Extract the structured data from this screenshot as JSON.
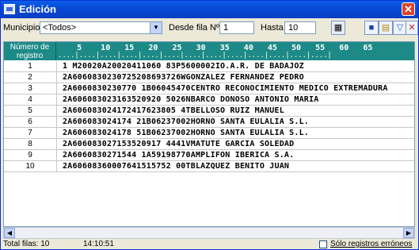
{
  "window": {
    "title": "Edición",
    "close_label": "✕"
  },
  "toolbar": {
    "municipio_label": "Municipio:",
    "municipio_value": "<Todos>",
    "desde_label": "Desde fila Nº:",
    "desde_value": "1",
    "hasta_label": "Hasta Nº:",
    "hasta_value": "10"
  },
  "grid": {
    "row_header": "Número de registro",
    "ruler_numbers": "    5    10   15   20   25   30   35   40   45   50   55   60   65",
    "ruler_ticks": "....|....|....|....|....|....|....|....|....|....|....|....|....|",
    "rows": [
      {
        "num": "1",
        "rec": "1 M20020A20020411060 83P5600002IO.A.R. DE BADAJOZ"
      },
      {
        "num": "2",
        "rec": "2A6060830230725208693726WGONZALEZ FERNANDEZ PEDRO"
      },
      {
        "num": "3",
        "rec": "2A6060830230770 1B06045470CENTRO RECONOCIMIENTO MEDICO EXTREMADURA"
      },
      {
        "num": "4",
        "rec": "2A606083023163520920 5026NBARCO DONOSO ANTONIO MARIA"
      },
      {
        "num": "5",
        "rec": "2A606083024172417623805 4TBELLOSO RUIZ MANUEL"
      },
      {
        "num": "6",
        "rec": "2A606083024174 21B06237002HORNO SANTA EULALIA S.L."
      },
      {
        "num": "7",
        "rec": "2A606083024178 51B06237002HORNO SANTA EULALIA S.L."
      },
      {
        "num": "8",
        "rec": "2A606083027153520917 4441VMATUTE GARCIA SOLEDAD"
      },
      {
        "num": "9",
        "rec": "2A6060830271544 1A59198770AMPLIFON IBERICA S.A."
      },
      {
        "num": "10",
        "rec": "2A60608360007641515752 00TBLAZQUEZ BENITO JUAN"
      }
    ]
  },
  "status": {
    "total": "Total filas: 10",
    "time": "14:10:51",
    "solo_label": "Sólo registros erróneos"
  }
}
